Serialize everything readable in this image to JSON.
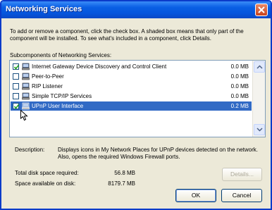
{
  "window": {
    "title": "Networking Services"
  },
  "intro_text": "To add or remove a component, click the check box. A shaded box means that only part of the component will be installed. To see what's included in a component, click Details.",
  "components_label": "Subcomponents of Networking Services:",
  "components": [
    {
      "name": "Internet Gateway Device Discovery and Control Client",
      "size": "0.0 MB",
      "checked": true,
      "selected": false
    },
    {
      "name": "Peer-to-Peer",
      "size": "0.0 MB",
      "checked": false,
      "selected": false
    },
    {
      "name": "RIP Listener",
      "size": "0.0 MB",
      "checked": false,
      "selected": false
    },
    {
      "name": "Simple TCP/IP Services",
      "size": "0.0 MB",
      "checked": false,
      "selected": false
    },
    {
      "name": "UPnP User Interface",
      "size": "0.2 MB",
      "checked": true,
      "selected": true
    }
  ],
  "description": {
    "label": "Description:",
    "text": "Displays icons in My Network Places for UPnP devices detected on the network. Also, opens the required Windows Firewall ports."
  },
  "disk": {
    "required_label": "Total disk space required:",
    "required_value": "56.8 MB",
    "available_label": "Space available on disk:",
    "available_value": "8179.7 MB"
  },
  "buttons": {
    "details": "Details...",
    "ok": "OK",
    "cancel": "Cancel"
  },
  "icons": {
    "close": "close-icon",
    "component": "network-component-icon",
    "cursor": "mouse-pointer-icon"
  },
  "colors": {
    "title_bar": "#0556dd",
    "selection": "#316ac5",
    "dialog_bg": "#ece9d8"
  }
}
